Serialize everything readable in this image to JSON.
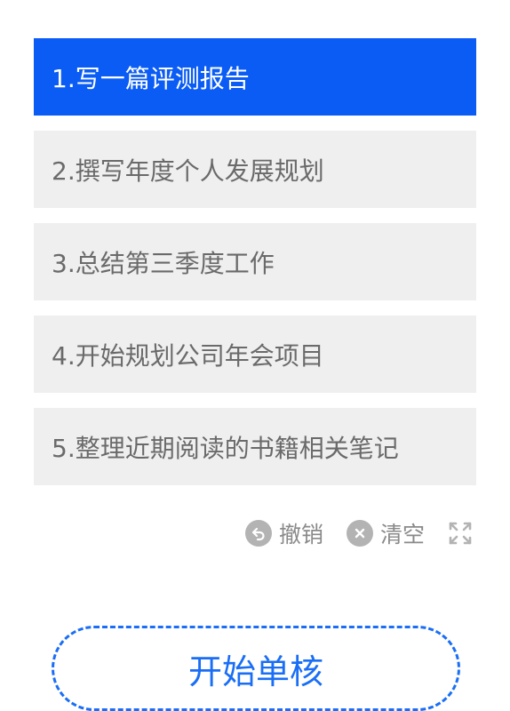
{
  "tasks": [
    {
      "label": "1.写一篇评测报告",
      "active": true
    },
    {
      "label": "2.撰写年度个人发展规划",
      "active": false
    },
    {
      "label": "3.总结第三季度工作",
      "active": false
    },
    {
      "label": "4.开始规划公司年会项目",
      "active": false
    },
    {
      "label": "5.整理近期阅读的书籍相关笔记",
      "active": false
    }
  ],
  "toolbar": {
    "undo_label": "撤销",
    "undo_icon": "undo-icon",
    "clear_label": "清空",
    "clear_icon": "clear-icon",
    "expand_icon": "expand-icon"
  },
  "start_button": {
    "label": "开始单核"
  },
  "colors": {
    "accent": "#0a5cf5",
    "item_bg": "#efefef",
    "item_text": "#6a6a6a",
    "toolbar_text": "#8a8a8a",
    "button_border": "#1a6ef5"
  }
}
